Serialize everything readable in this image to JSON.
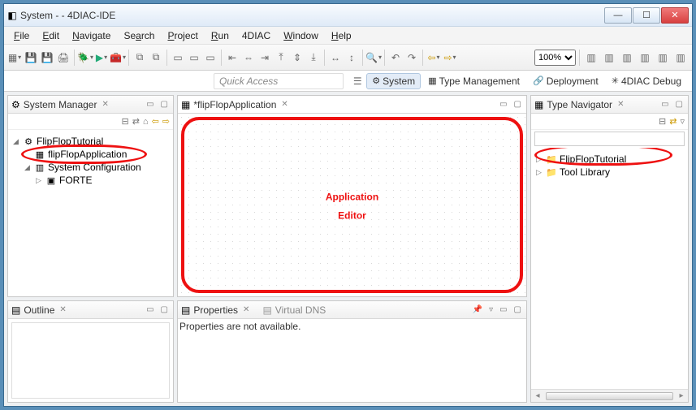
{
  "window": {
    "title": "System -  - 4DIAC-IDE"
  },
  "menu": {
    "file": "File",
    "edit": "Edit",
    "navigate": "Navigate",
    "search": "Search",
    "project": "Project",
    "run": "Run",
    "fdiac": "4DIAC",
    "window": "Window",
    "help": "Help"
  },
  "toolbar": {
    "zoom": "100%"
  },
  "quickaccess": {
    "placeholder": "Quick Access"
  },
  "perspectives": {
    "system": "System",
    "typemgmt": "Type Management",
    "deploy": "Deployment",
    "debug": "4DIAC Debug"
  },
  "views": {
    "sysmgr": {
      "title": "System Manager",
      "tree": {
        "root": "FlipFlopTutorial",
        "app": "flipFlopApplication",
        "syscfg": "System Configuration",
        "forte": "FORTE"
      }
    },
    "outline": {
      "title": "Outline"
    },
    "editor": {
      "tab": "*flipFlopApplication",
      "labelTop": "Application",
      "labelBottom": "Editor"
    },
    "props": {
      "title": "Properties",
      "vdns": "Virtual DNS",
      "body": "Properties are not available."
    },
    "typenav": {
      "title": "Type Navigator",
      "tree": {
        "root": "FlipFlopTutorial",
        "lib": "Tool Library"
      }
    }
  }
}
